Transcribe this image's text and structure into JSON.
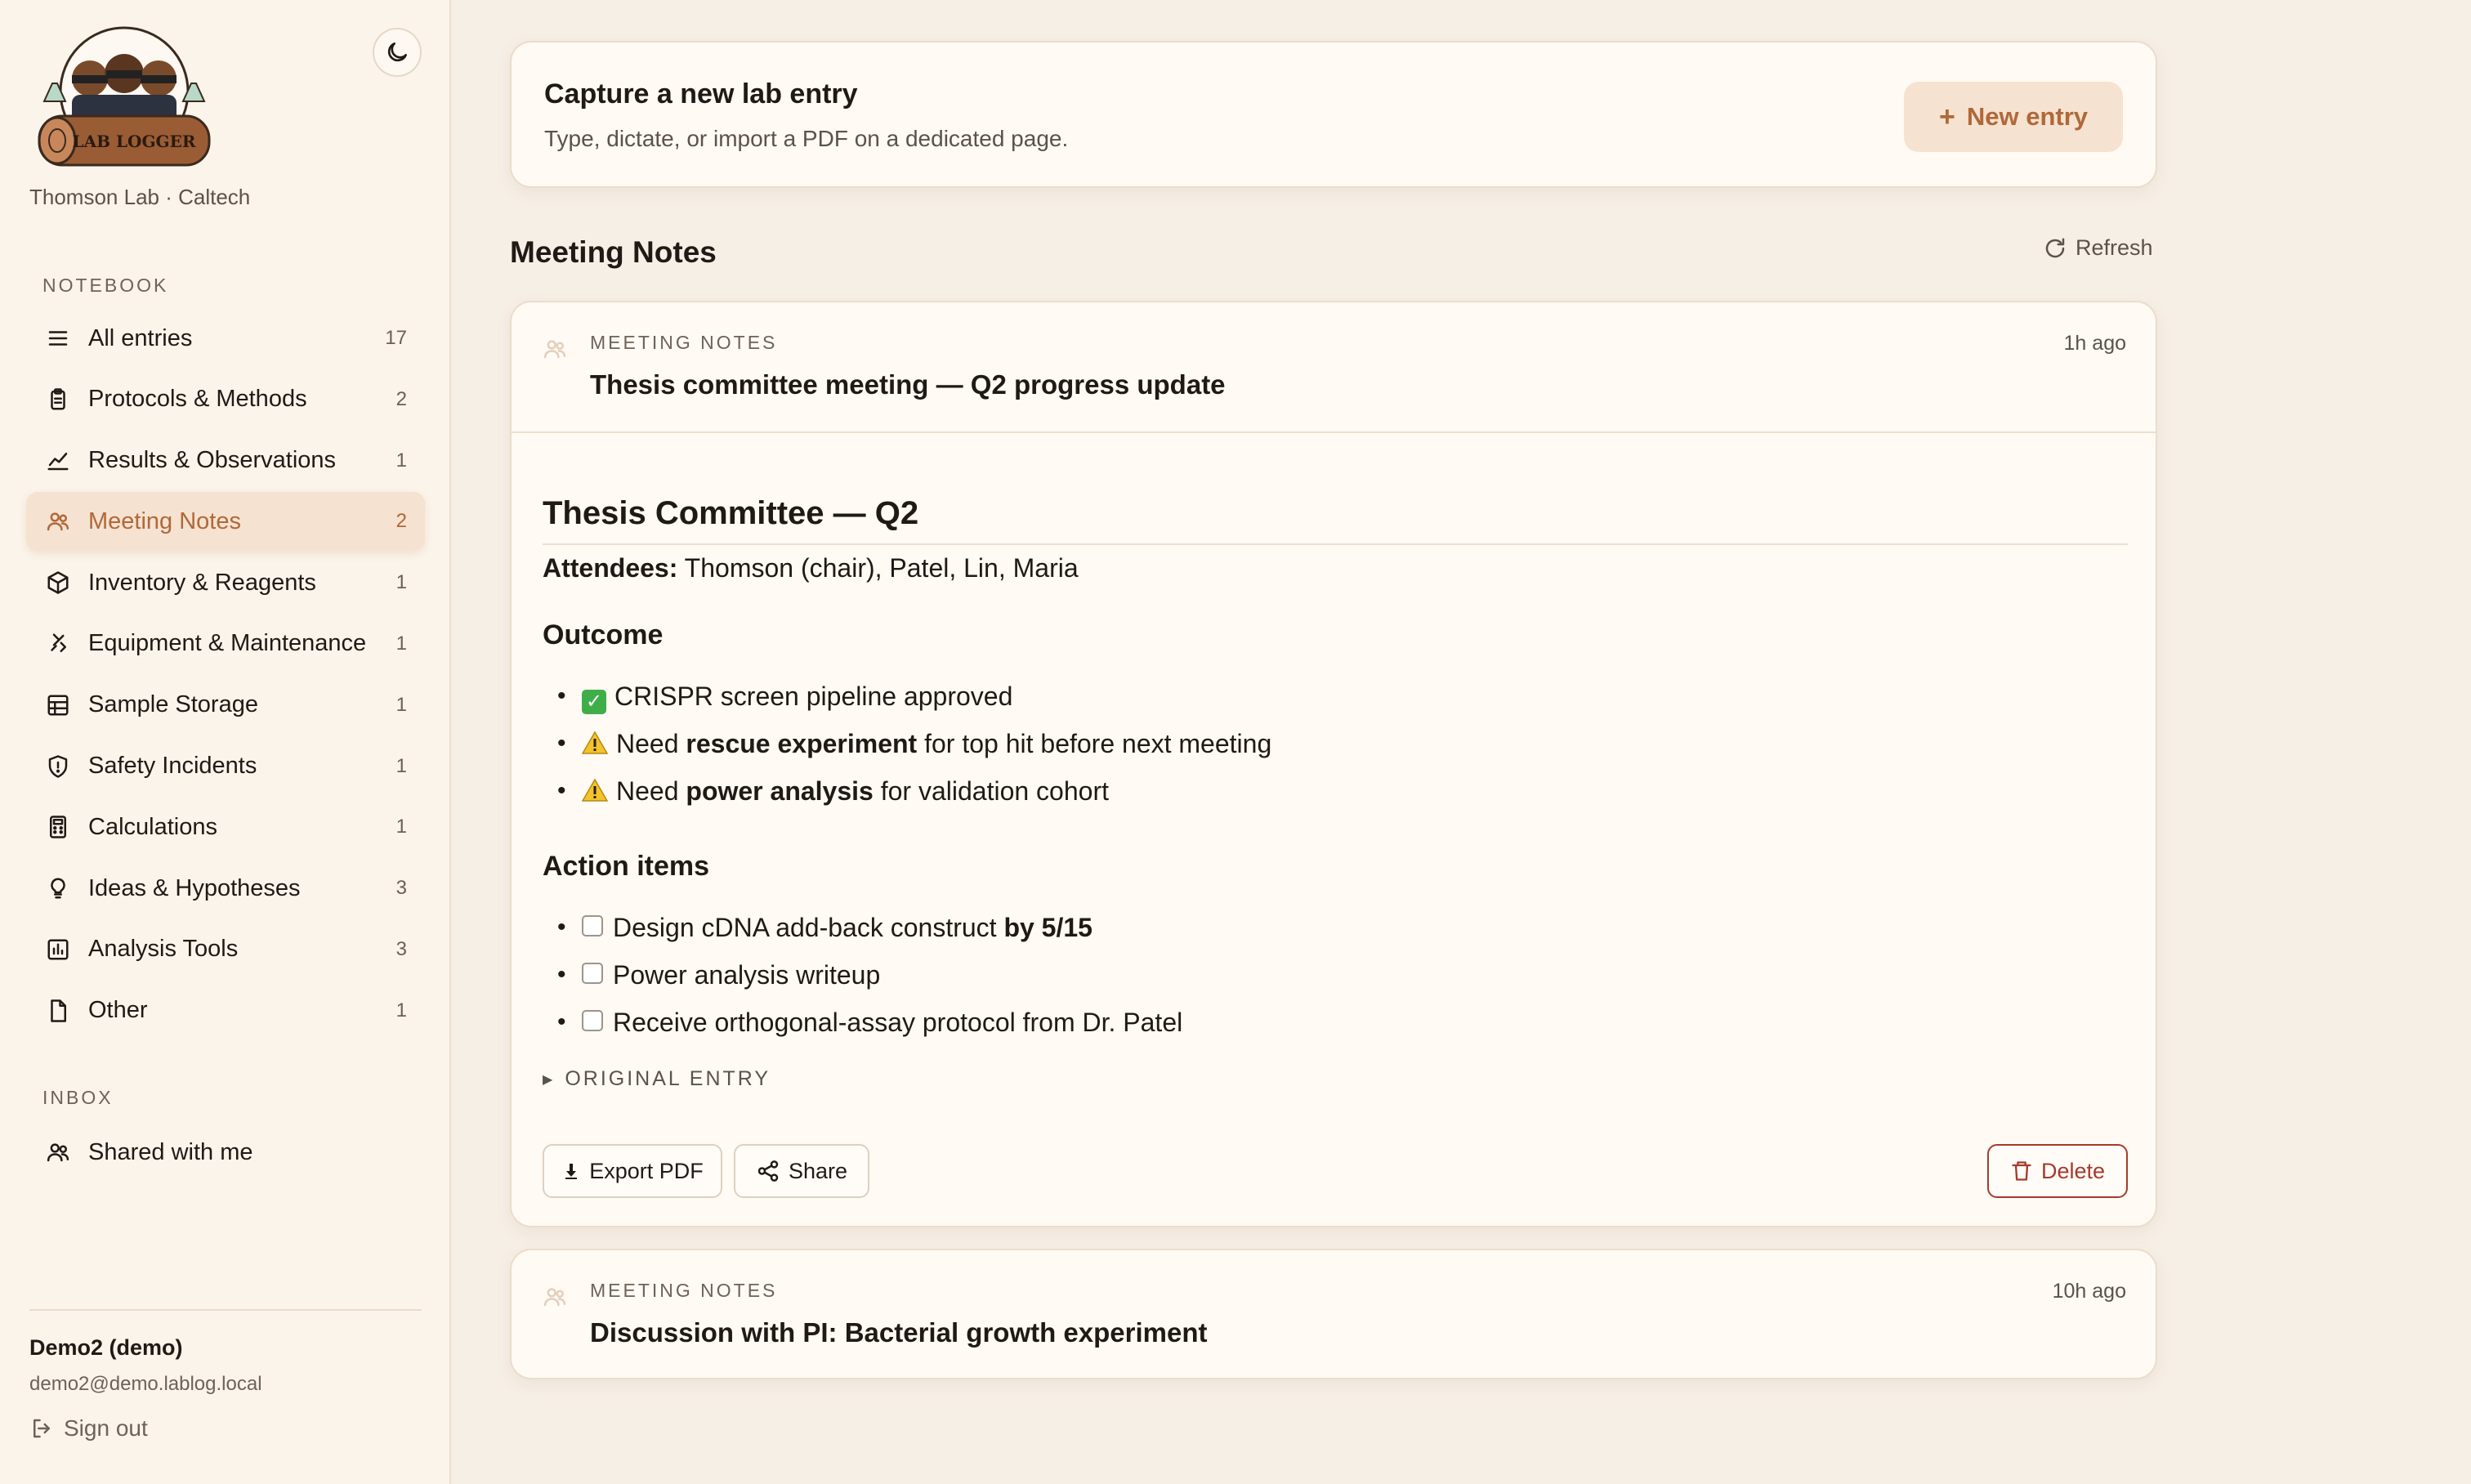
{
  "sidebar": {
    "logo_text": "LAB LOGGER",
    "lab_name": "Thomson Lab · Caltech",
    "notebook_label": "NOTEBOOK",
    "inbox_label": "INBOX",
    "items": [
      {
        "label": "All entries",
        "count": "17",
        "icon": "menu-icon"
      },
      {
        "label": "Protocols & Methods",
        "count": "2",
        "icon": "clipboard-icon"
      },
      {
        "label": "Results & Observations",
        "count": "1",
        "icon": "chart-line-icon"
      },
      {
        "label": "Meeting Notes",
        "count": "2",
        "icon": "users-icon",
        "active": true
      },
      {
        "label": "Inventory & Reagents",
        "count": "1",
        "icon": "box-icon"
      },
      {
        "label": "Equipment & Maintenance",
        "count": "1",
        "icon": "wrench-icon"
      },
      {
        "label": "Sample Storage",
        "count": "1",
        "icon": "grid-icon"
      },
      {
        "label": "Safety Incidents",
        "count": "1",
        "icon": "shield-icon"
      },
      {
        "label": "Calculations",
        "count": "1",
        "icon": "calculator-icon"
      },
      {
        "label": "Ideas & Hypotheses",
        "count": "3",
        "icon": "lightbulb-icon"
      },
      {
        "label": "Analysis Tools",
        "count": "3",
        "icon": "bar-chart-icon"
      },
      {
        "label": "Other",
        "count": "1",
        "icon": "file-icon"
      }
    ],
    "inbox_items": [
      {
        "label": "Shared with me",
        "icon": "users-icon"
      }
    ],
    "user": {
      "name": "Demo2 (demo)",
      "email": "demo2@demo.lablog.local",
      "sign_out": "Sign out"
    }
  },
  "capture": {
    "title": "Capture a new lab entry",
    "subtitle": "Type, dictate, or import a PDF on a dedicated page.",
    "button": "New entry"
  },
  "section": {
    "title": "Meeting Notes",
    "refresh": "Refresh"
  },
  "entries": [
    {
      "category": "MEETING NOTES",
      "time": "1h ago",
      "title": "Thesis committee meeting — Q2 progress update",
      "doc": {
        "h1": "Thesis Committee — Q2",
        "attendees_label": "Attendees:",
        "attendees": "Thomson (chair), Patel, Lin, Maria",
        "outcome_heading": "Outcome",
        "outcome": [
          {
            "pre": "CRISPR screen pipeline approved",
            "bold": "",
            "post": ""
          },
          {
            "pre": "Need ",
            "bold": "rescue experiment",
            "post": " for top hit before next meeting"
          },
          {
            "pre": "Need ",
            "bold": "power analysis",
            "post": " for validation cohort"
          }
        ],
        "actions_heading": "Action items",
        "actions": [
          {
            "pre": "Design cDNA add-back construct ",
            "bold": "by 5/15"
          },
          {
            "pre": "Power analysis writeup",
            "bold": ""
          },
          {
            "pre": "Receive orthogonal-assay protocol from Dr. Patel",
            "bold": ""
          }
        ],
        "original_entry": "ORIGINAL ENTRY"
      },
      "buttons": {
        "export": "Export PDF",
        "share": "Share",
        "delete": "Delete"
      }
    },
    {
      "category": "MEETING NOTES",
      "time": "10h ago",
      "title": "Discussion with PI: Bacterial growth experiment"
    }
  ]
}
